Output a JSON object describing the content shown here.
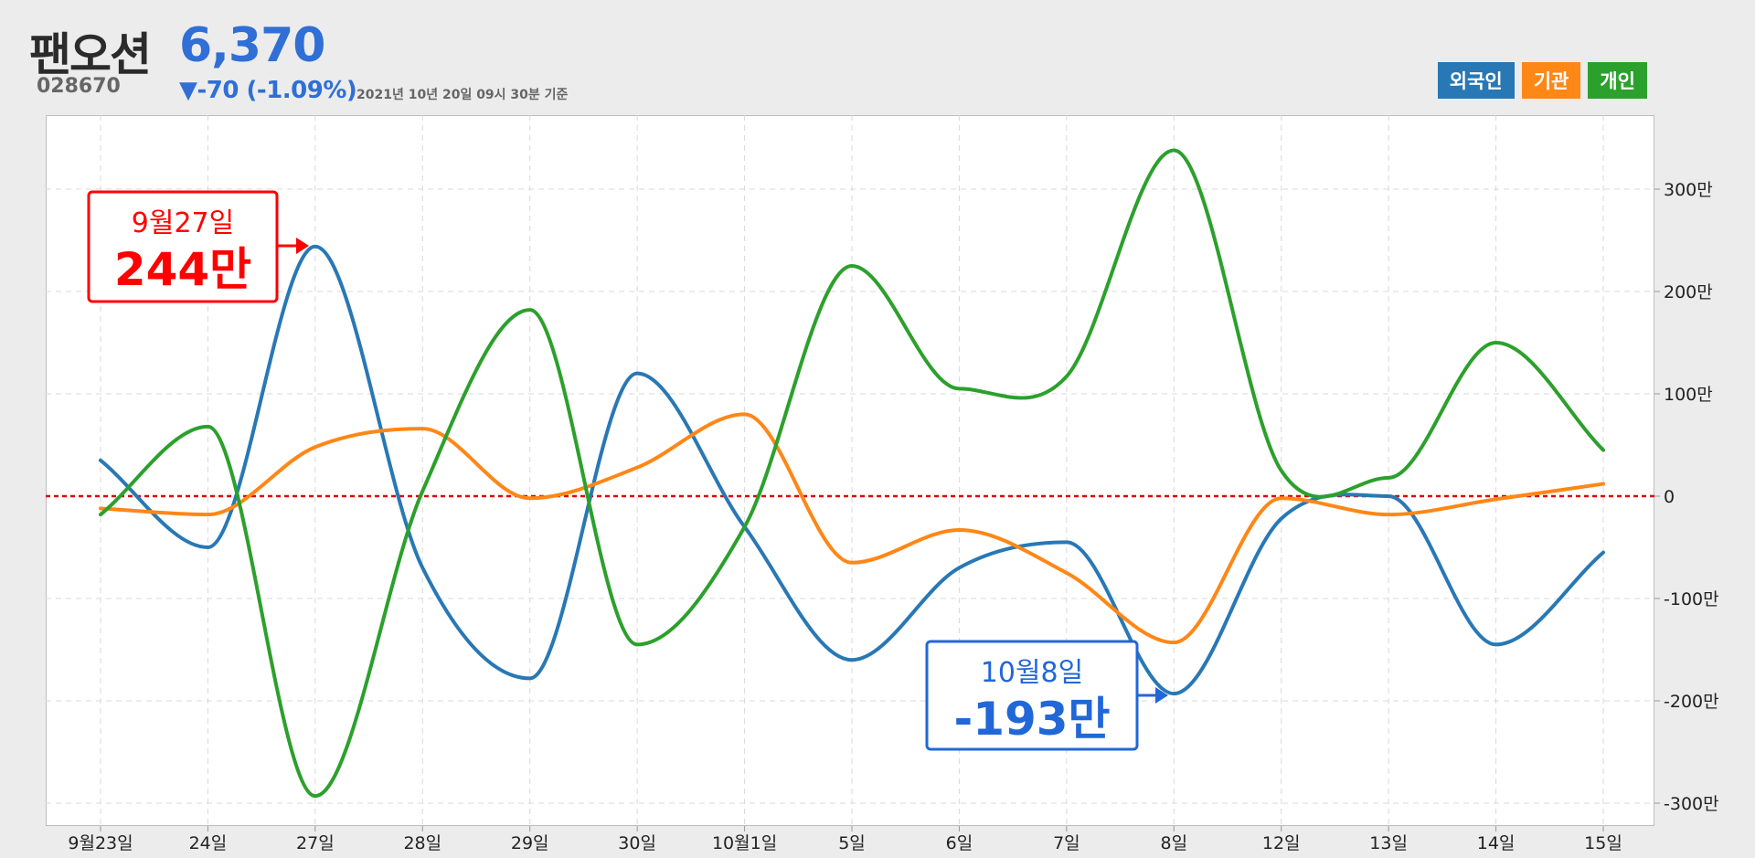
{
  "stock": {
    "name": "팬오션",
    "code": "028670",
    "price": "6,370",
    "change": "▼-70 (-1.09%)",
    "timestamp": "2021년 10년 20일 09시 30분 기준"
  },
  "legend": {
    "foreign": "외국인",
    "institution": "기관",
    "individual": "개인"
  },
  "colors": {
    "foreign": "#2878b5",
    "institution": "#ff8716",
    "individual": "#2ca02c",
    "zero_line": "#e00000",
    "price_text": "#2f6fd6"
  },
  "chart_data": {
    "type": "line",
    "categories": [
      "9월23일",
      "24일",
      "27일",
      "28일",
      "29일",
      "30일",
      "10월1일",
      "5일",
      "6일",
      "7일",
      "8일",
      "12일",
      "13일",
      "14일",
      "15일"
    ],
    "series": [
      {
        "name": "외국인",
        "color": "#2878b5",
        "values": [
          35,
          -50,
          244,
          -70,
          -178,
          120,
          -30,
          -160,
          -70,
          -45,
          -193,
          -22,
          0,
          -145,
          -55
        ]
      },
      {
        "name": "기관",
        "color": "#ff8716",
        "values": [
          -12,
          -18,
          48,
          66,
          -2,
          28,
          80,
          -65,
          -33,
          -75,
          -143,
          -2,
          -18,
          -3,
          12
        ]
      },
      {
        "name": "개인",
        "color": "#2ca02c",
        "values": [
          -18,
          68,
          -293,
          5,
          182,
          -145,
          -30,
          225,
          105,
          117,
          338,
          25,
          18,
          150,
          45
        ]
      }
    ],
    "yticks": [
      300,
      200,
      100,
      0,
      -100,
      -200,
      -300
    ],
    "ytick_labels": [
      "300만",
      "200만",
      "100만",
      "0",
      "-100만",
      "-200만",
      "-300만"
    ],
    "ylim": [
      -320,
      365
    ],
    "grid": true,
    "reference_line": 0,
    "annotations": [
      {
        "date": "9월27일",
        "value_label": "244만",
        "index": 2,
        "value": 244,
        "color": "#ff0000"
      },
      {
        "date": "10월8일",
        "value_label": "-193만",
        "index": 10,
        "value": -193,
        "color": "#2167d8"
      }
    ]
  }
}
